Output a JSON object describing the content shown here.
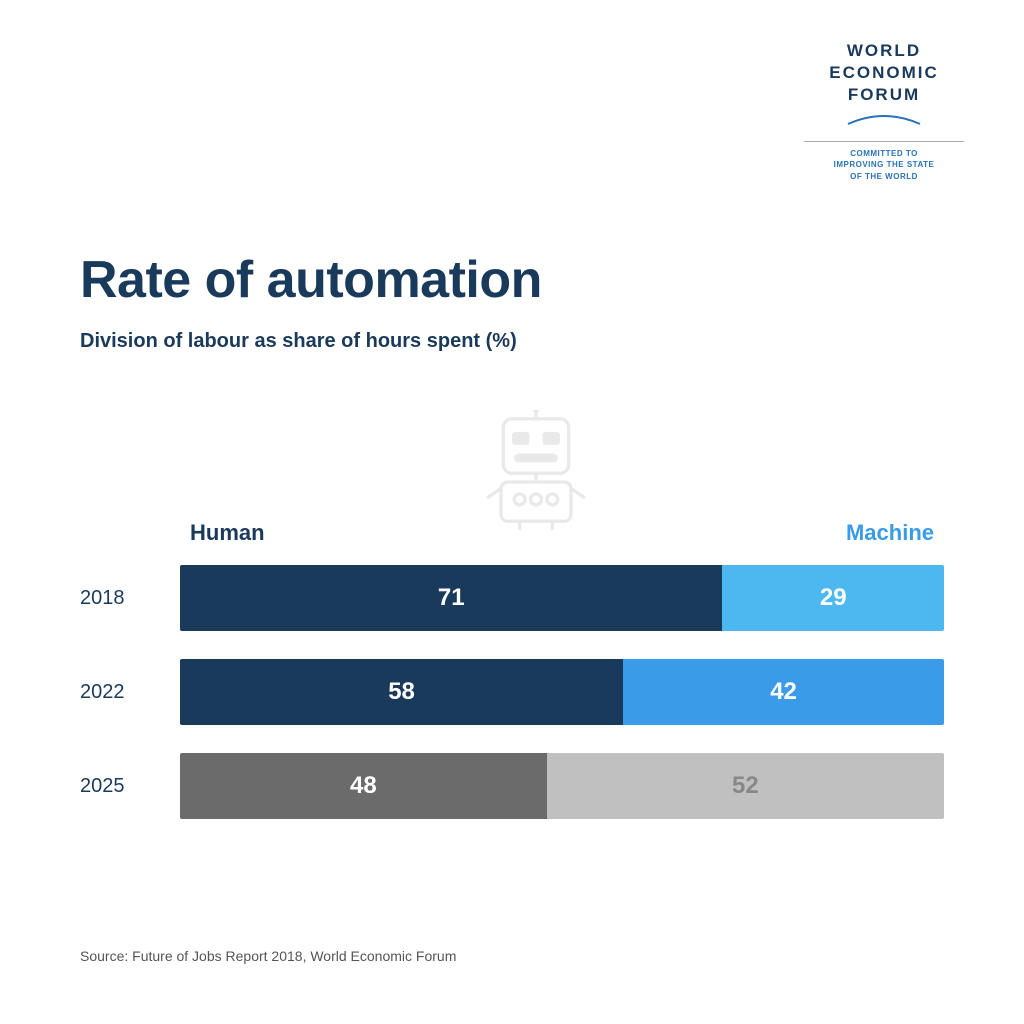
{
  "logo": {
    "line1": "WORLD",
    "line2": "ECONOMIC",
    "line3": "FORUM",
    "tagline_line1": "COMMITTED TO",
    "tagline_line2": "IMPROVING THE STATE",
    "tagline_line3": "OF THE WORLD"
  },
  "chart": {
    "main_title": "Rate of automation",
    "subtitle": "Division of labour as share of hours spent (%)",
    "col_human": "Human",
    "col_machine": "Machine",
    "rows": [
      {
        "year": "2018",
        "human_pct": 71,
        "machine_pct": 29,
        "type": "2018"
      },
      {
        "year": "2022",
        "human_pct": 58,
        "machine_pct": 42,
        "type": "2022"
      },
      {
        "year": "2025",
        "human_pct": 48,
        "machine_pct": 52,
        "type": "2025"
      }
    ]
  },
  "source": "Source: Future of Jobs Report 2018, World Economic Forum"
}
